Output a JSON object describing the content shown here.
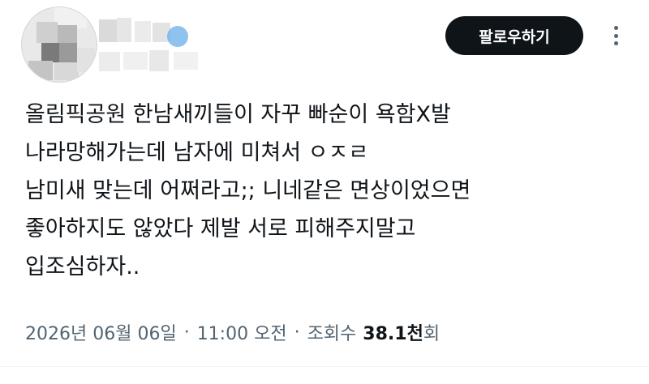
{
  "header": {
    "follow_label": "팔로우하기"
  },
  "tweet": {
    "lines": [
      "올림픽공원 한남새끼들이 자꾸 빠순이 욕함X발",
      "나라망해가는데 남자에 미쳐서 ㅇㅈㄹ",
      "남미새 맞는데 어쩌라고;; 니네같은 면상이었으면",
      "좋아하지도 않았다 제발 서로 피해주지말고",
      "입조심하자.."
    ]
  },
  "meta": {
    "date": "2026년 06월 06일",
    "time": "11:00 오전",
    "separator": "·",
    "views_label_prefix": "조회수",
    "views_count": "38.1천",
    "views_suffix": "회"
  },
  "icons": {
    "more": "more-horizontal-icon",
    "verified": "verified-badge-icon"
  }
}
